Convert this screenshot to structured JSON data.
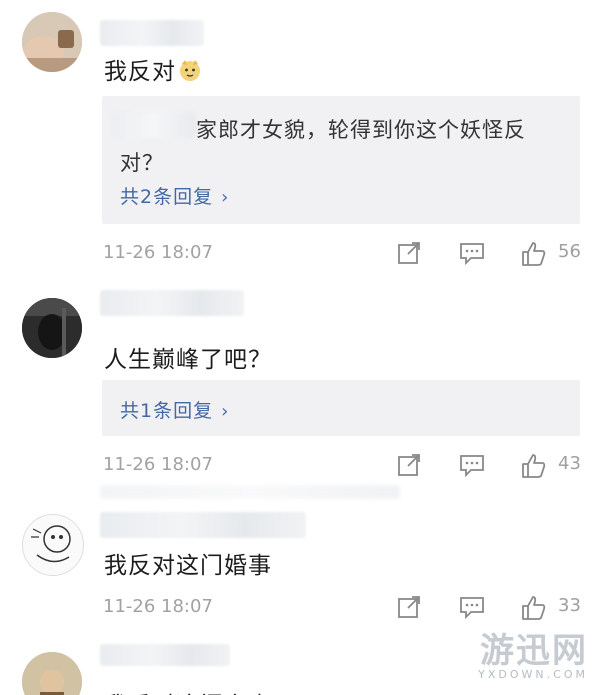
{
  "comments": [
    {
      "text": "我反对",
      "emoji": "doge-emoji",
      "reply": {
        "body_visible": "家郎才女貌，轮得到你这个妖怪反对？",
        "line1": "家郎才女貌，轮得到你这个妖怪反",
        "line2": "对？",
        "link": "共2条回复"
      },
      "time": "11-26 18:07",
      "likes": "56"
    },
    {
      "text": "人生巅峰了吧？",
      "reply": {
        "link": "共1条回复"
      },
      "time": "11-26 18:07",
      "likes": "43"
    },
    {
      "text": "我反对这门婚事",
      "time": "11-26 18:07",
      "likes": "33"
    },
    {
      "text": "我反对这门亲事"
    }
  ],
  "watermark": {
    "main": "游迅网",
    "sub": "YXDOWN.COM"
  },
  "colors": {
    "link": "#4468a6",
    "reply_bg": "#f1f1f3",
    "meta": "#a2a2a2"
  }
}
